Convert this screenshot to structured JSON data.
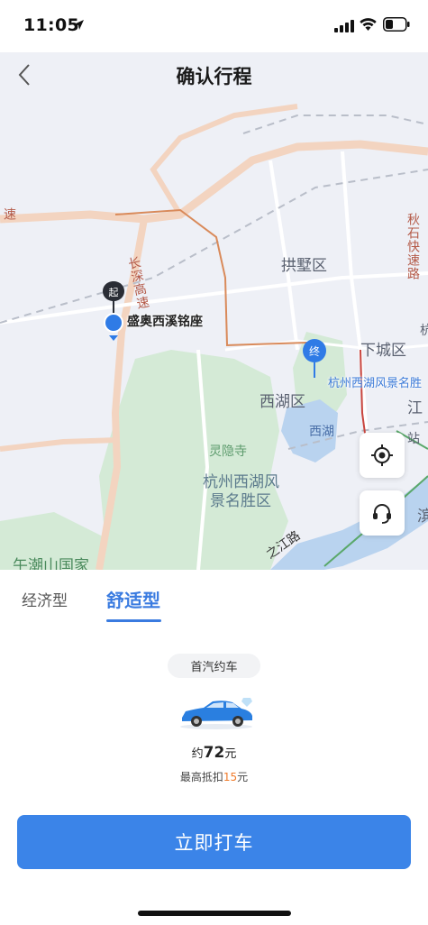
{
  "status_bar": {
    "time": "11:05"
  },
  "header": {
    "title": "确认行程"
  },
  "map": {
    "labels": {
      "gongshu": "拱墅区",
      "xiacheng": "下城区",
      "xihu_district": "西湖区",
      "xihu_lake": "西湖",
      "jiang": "江",
      "lingyin": "灵隐寺",
      "scenic_1": "杭州西湖风",
      "scenic_2": "景名胜区",
      "wuchao": "午潮山国家",
      "zhijiang": "之江路",
      "changshen": "长深高速",
      "qiushi": "秋石快速路",
      "sui": "速",
      "zhan": "站",
      "edge_right": "杭",
      "edge_bottom_right": "滨"
    },
    "start_pin_text": "起",
    "start_name": "盛奥西溪铭座",
    "end_pin_text": "终",
    "end_name": "杭州西湖风景名胜"
  },
  "tabs": [
    {
      "label": "经济型",
      "active": false
    },
    {
      "label": "舒适型",
      "active": true
    }
  ],
  "ride": {
    "provider": "首汽约车",
    "price_prefix": "约",
    "price_value": "72",
    "price_unit": "元",
    "discount_prefix": "最高抵扣",
    "discount_value": "15",
    "discount_unit": "元"
  },
  "cta_label": "立即打车",
  "colors": {
    "accent": "#3b84e8",
    "discount": "#f07a2a"
  }
}
